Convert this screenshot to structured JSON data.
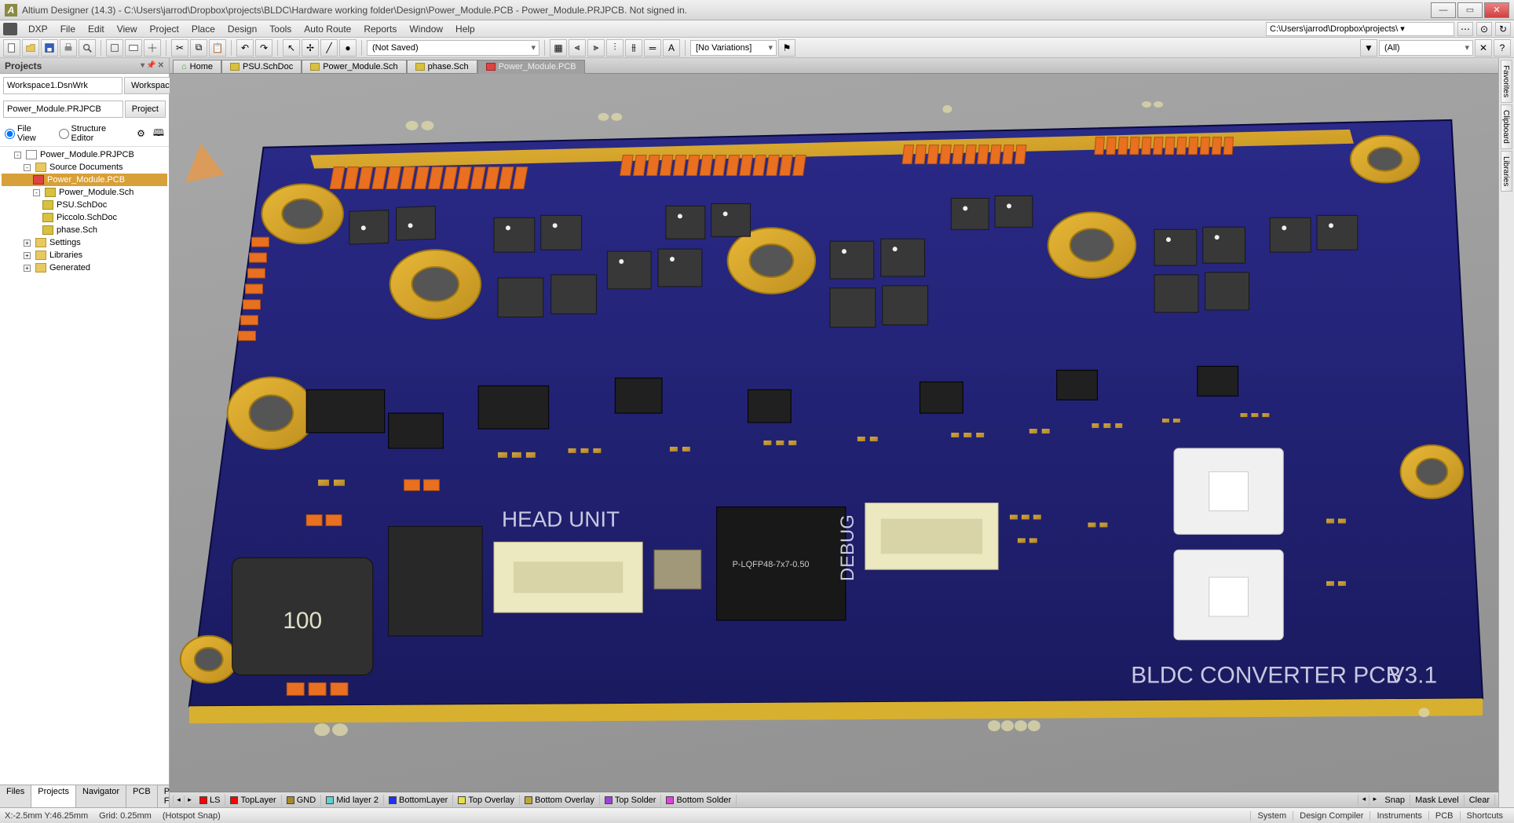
{
  "window": {
    "title": "Altium Designer (14.3) - C:\\Users\\jarrod\\Dropbox\\projects\\BLDC\\Hardware working folder\\Design\\Power_Module.PCB - Power_Module.PRJPCB. Not signed in."
  },
  "menubar": {
    "items": [
      "DXP",
      "File",
      "Edit",
      "View",
      "Project",
      "Place",
      "Design",
      "Tools",
      "Auto Route",
      "Reports",
      "Window",
      "Help"
    ],
    "path_hint": "C:\\Users\\jarrod\\Dropbox\\projects\\ ▾"
  },
  "toolbar": {
    "combo1": "(Not Saved)",
    "combo2": "[No Variations]",
    "combo3": "(All)"
  },
  "projects_panel": {
    "title": "Projects",
    "workspace": "Workspace1.DsnWrk",
    "workspace_btn": "Workspace",
    "project_file": "Power_Module.PRJPCB",
    "project_btn": "Project",
    "fileview": "File View",
    "structed": "Structure Editor",
    "tree": [
      {
        "lvl": 0,
        "kind": "project",
        "label": "Power_Module.PRJPCB",
        "exp": "-"
      },
      {
        "lvl": 1,
        "kind": "folder",
        "label": "Source Documents",
        "exp": "-"
      },
      {
        "lvl": 2,
        "kind": "pcb",
        "label": "Power_Module.PCB",
        "sel": true
      },
      {
        "lvl": 2,
        "kind": "sch",
        "label": "Power_Module.Sch",
        "exp": "-"
      },
      {
        "lvl": 3,
        "kind": "sch",
        "label": "PSU.SchDoc"
      },
      {
        "lvl": 3,
        "kind": "sch",
        "label": "Piccolo.SchDoc"
      },
      {
        "lvl": 3,
        "kind": "sch",
        "label": "phase.Sch"
      },
      {
        "lvl": 1,
        "kind": "folder",
        "label": "Settings",
        "exp": "+"
      },
      {
        "lvl": 1,
        "kind": "folder",
        "label": "Libraries",
        "exp": "+"
      },
      {
        "lvl": 1,
        "kind": "folder",
        "label": "Generated",
        "exp": "+"
      }
    ]
  },
  "bottom_tabs": [
    "Files",
    "Projects",
    "Navigator",
    "PCB",
    "PCB Filter"
  ],
  "bottom_tab_active": "Projects",
  "doc_tabs": [
    {
      "label": "Home",
      "kind": "home"
    },
    {
      "label": "PSU.SchDoc",
      "kind": "sch"
    },
    {
      "label": "Power_Module.Sch",
      "kind": "sch"
    },
    {
      "label": "phase.Sch",
      "kind": "sch"
    },
    {
      "label": "Power_Module.PCB",
      "kind": "pcb",
      "active": true
    }
  ],
  "layers": [
    {
      "label": "LS",
      "color": "#ff0000"
    },
    {
      "label": "TopLayer",
      "color": "#ff0000"
    },
    {
      "label": "GND",
      "color": "#a88828"
    },
    {
      "label": "Mid layer 2",
      "color": "#60d0d0"
    },
    {
      "label": "BottomLayer",
      "color": "#2030ff"
    },
    {
      "label": "Top Overlay",
      "color": "#e8e040"
    },
    {
      "label": "Bottom Overlay",
      "color": "#c0a830"
    },
    {
      "label": "Top Solder",
      "color": "#a040e0"
    },
    {
      "label": "Bottom Solder",
      "color": "#e040e0"
    }
  ],
  "layer_right": [
    "Snap",
    "Mask Level",
    "Clear"
  ],
  "right_tabs": [
    "Favorites",
    "Clipboard",
    "Libraries"
  ],
  "statusbar": {
    "coords": "X:-2.5mm Y:46.25mm",
    "grid": "Grid: 0.25mm",
    "snap": "(Hotspot Snap)",
    "right": [
      "System",
      "Design Compiler",
      "Instruments",
      "PCB",
      "Shortcuts"
    ]
  },
  "pcb": {
    "silkscreen": {
      "head_unit": "HEAD UNIT",
      "debug": "DEBUG",
      "title_name": "BLDC CONVERTER PCB",
      "title_ver": "V3.1",
      "chip_marking": "P-LQFP48-7x7-0.50",
      "inductor_value": "100"
    }
  }
}
